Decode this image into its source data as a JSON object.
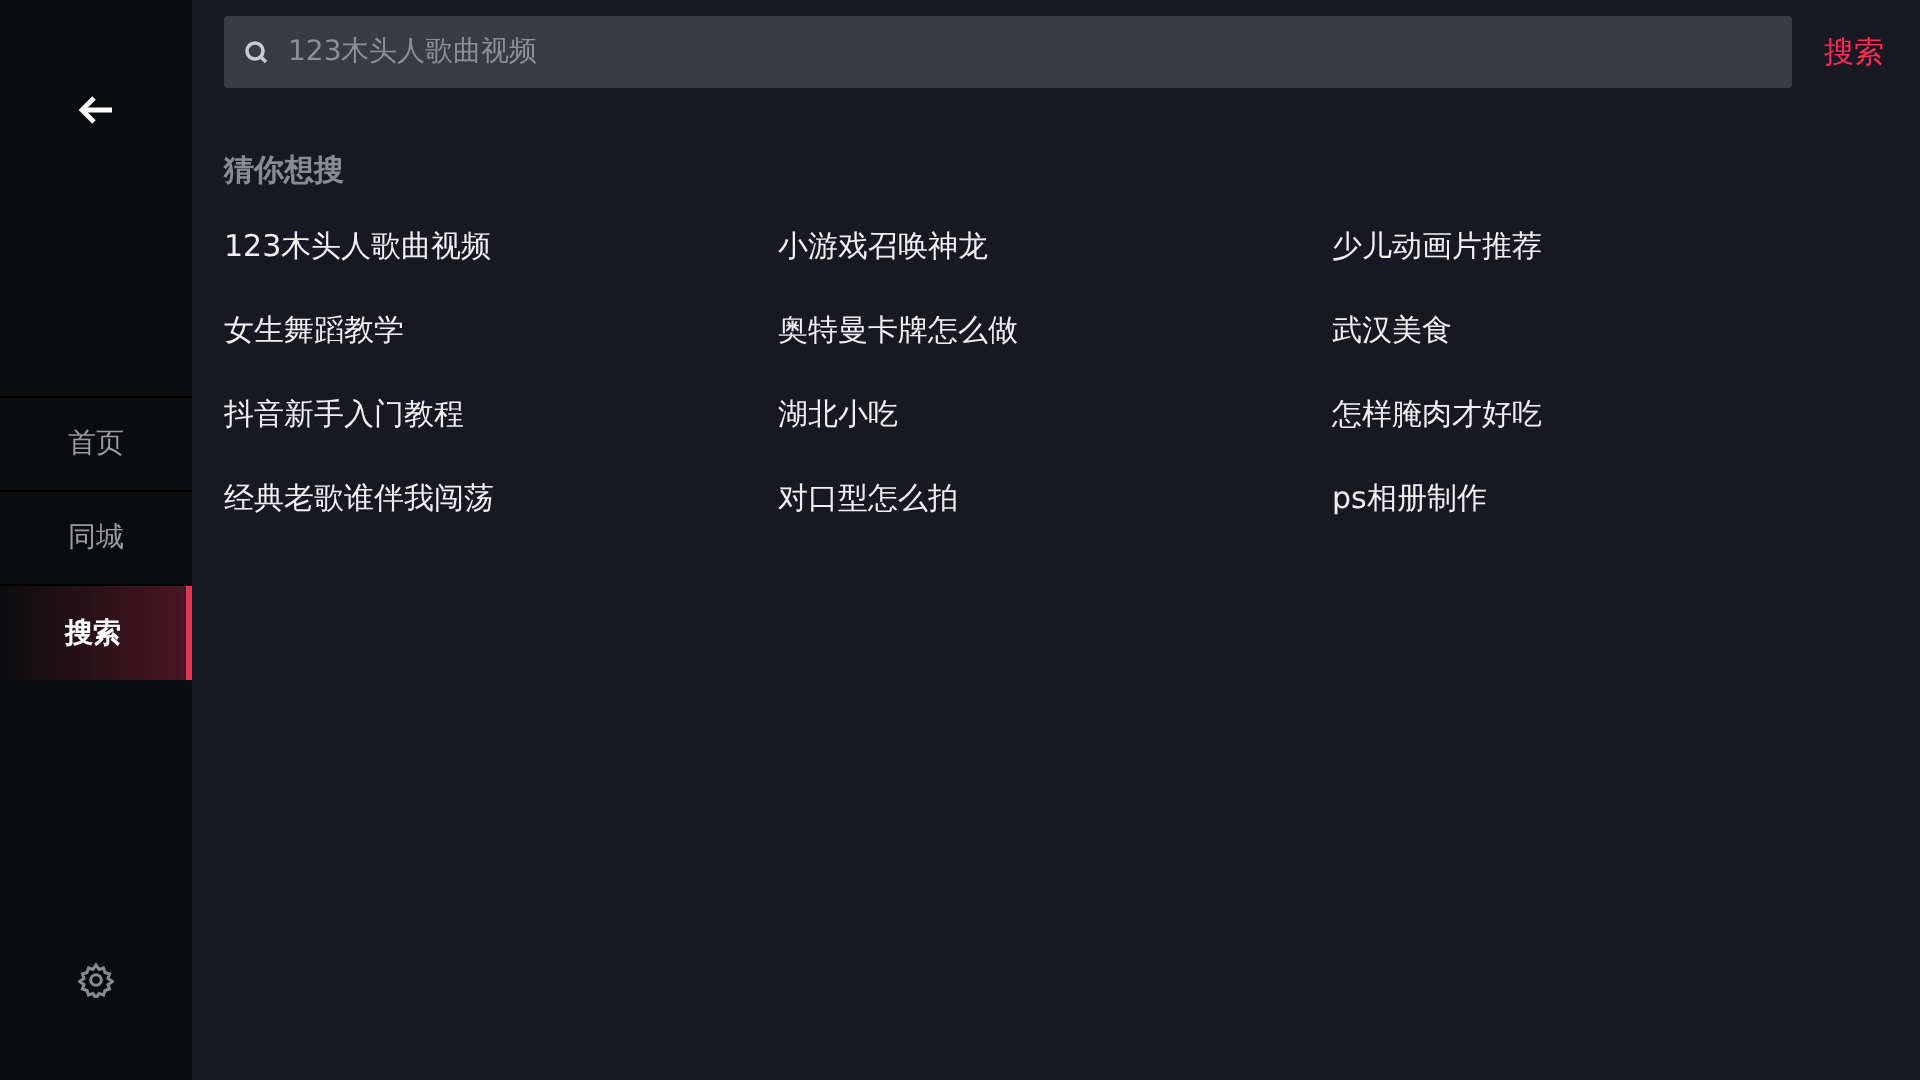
{
  "sidebar": {
    "nav": [
      {
        "label": "首页",
        "selected": false
      },
      {
        "label": "同城",
        "selected": false
      },
      {
        "label": "搜索",
        "selected": true
      }
    ]
  },
  "search": {
    "placeholder": "123木头人歌曲视频",
    "button": "搜索"
  },
  "suggestions": {
    "title": "猜你想搜",
    "items": [
      "123木头人歌曲视频",
      "小游戏召唤神龙",
      "少儿动画片推荐",
      "女生舞蹈教学",
      "奥特曼卡牌怎么做",
      "武汉美食",
      "抖音新手入门教程",
      "湖北小吃",
      "怎样腌肉才好吃",
      "经典老歌谁伴我闯荡",
      "对口型怎么拍",
      "ps相册制作"
    ]
  }
}
